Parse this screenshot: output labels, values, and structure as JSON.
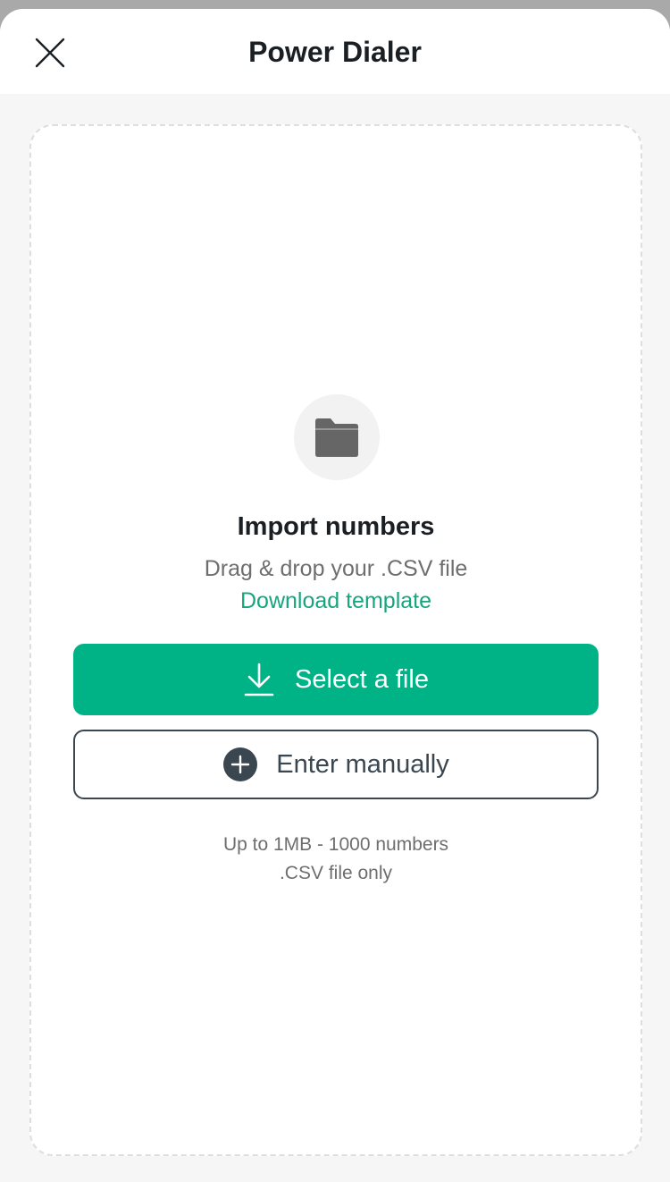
{
  "header": {
    "title": "Power Dialer",
    "close_icon": "close-icon"
  },
  "import": {
    "icon": "folder-icon",
    "title": "Import numbers",
    "drag_text": "Drag & drop your .CSV file",
    "download_link": "Download template",
    "select_button": {
      "icon": "download-icon",
      "label": "Select a file"
    },
    "manual_button": {
      "icon": "plus-circle-icon",
      "label": "Enter manually"
    },
    "limits": {
      "size_text": "Up to 1MB - 1000 numbers",
      "type_text": ".CSV file only"
    }
  },
  "colors": {
    "accent": "#00b386",
    "link": "#16a57e",
    "dark": "#3b4750"
  }
}
